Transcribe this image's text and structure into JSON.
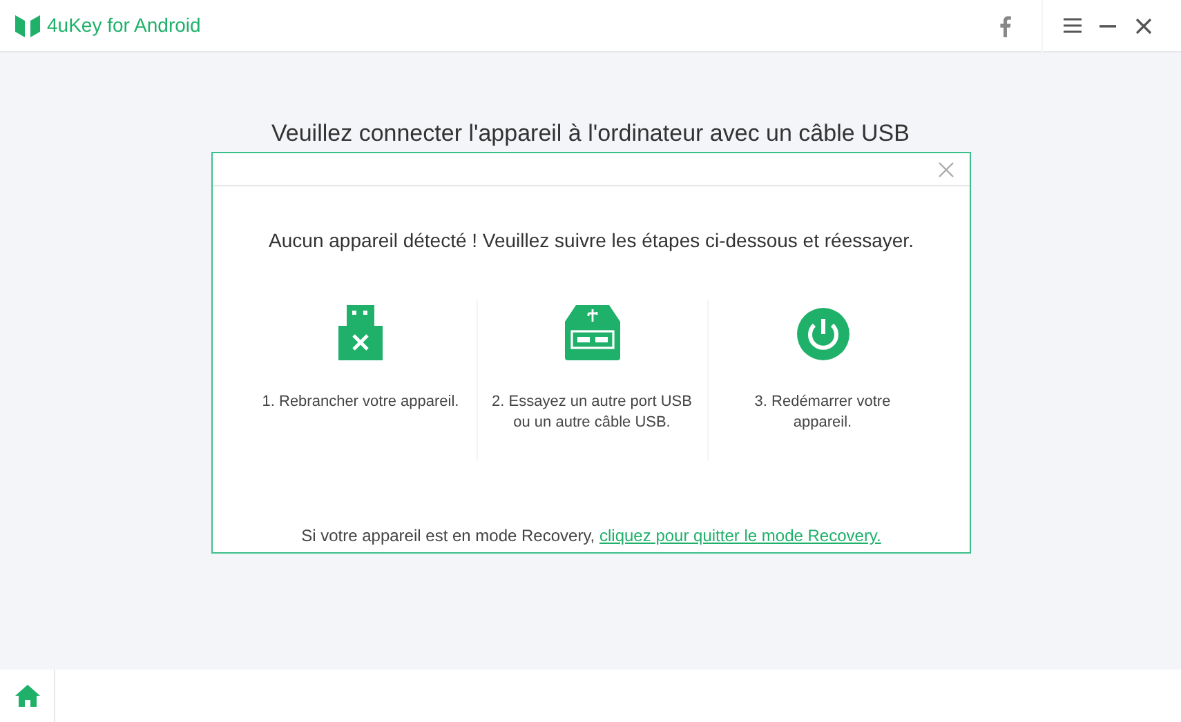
{
  "window": {
    "title": "4uKey for Android"
  },
  "heading": "Veuillez connecter l'appareil à l'ordinateur avec un câble USB",
  "dialog": {
    "message": "Aucun appareil détecté ! Veuillez suivre les étapes ci-dessous et réessayer.",
    "steps": [
      {
        "kind": "usb-x",
        "text": "1. Rebrancher votre appareil."
      },
      {
        "kind": "usb-port",
        "text": "2. Essayez un autre port USB ou un autre câble USB."
      },
      {
        "kind": "power",
        "text": "3. Redémarrer votre appareil."
      }
    ],
    "note": "Si votre appareil est en mode Recovery,",
    "link": "cliquez pour quitter le mode Recovery."
  }
}
